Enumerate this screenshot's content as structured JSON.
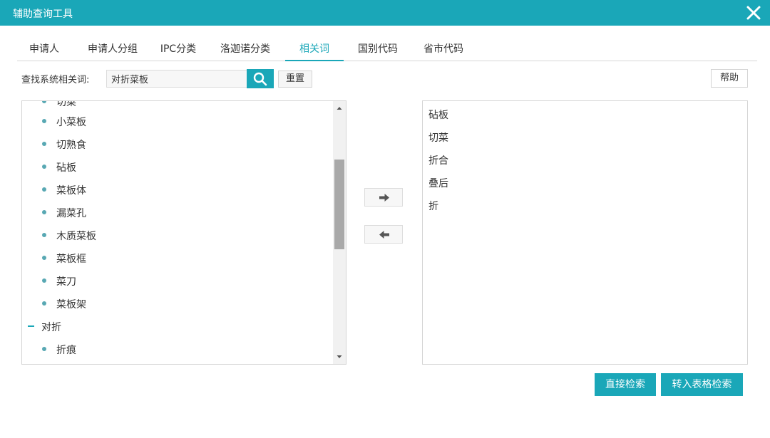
{
  "window": {
    "title": "辅助查询工具"
  },
  "tabs": [
    {
      "label": "申请人",
      "active": false
    },
    {
      "label": "申请人分组",
      "active": false
    },
    {
      "label": "IPC分类",
      "active": false
    },
    {
      "label": "洛迦诺分类",
      "active": false
    },
    {
      "label": "相关词",
      "active": true
    },
    {
      "label": "国别代码",
      "active": false
    },
    {
      "label": "省市代码",
      "active": false
    }
  ],
  "search": {
    "label": "查找系统相关词:",
    "value": "对折菜板",
    "reset_label": "重置",
    "help_label": "帮助"
  },
  "tree": {
    "items": [
      {
        "label": "切菜",
        "type": "leaf"
      },
      {
        "label": "小菜板",
        "type": "leaf"
      },
      {
        "label": "切熟食",
        "type": "leaf"
      },
      {
        "label": "砧板",
        "type": "leaf"
      },
      {
        "label": "菜板体",
        "type": "leaf"
      },
      {
        "label": "漏菜孔",
        "type": "leaf"
      },
      {
        "label": "木质菜板",
        "type": "leaf"
      },
      {
        "label": "菜板框",
        "type": "leaf"
      },
      {
        "label": "菜刀",
        "type": "leaf"
      },
      {
        "label": "菜板架",
        "type": "leaf"
      },
      {
        "label": "对折",
        "type": "group"
      },
      {
        "label": "折痕",
        "type": "leaf"
      }
    ]
  },
  "results": {
    "items": [
      "砧板",
      "切菜",
      "折合",
      "叠后",
      "折"
    ]
  },
  "actions": {
    "direct_search": "直接检索",
    "table_search": "转入表格检索"
  },
  "colors": {
    "accent": "#1aa7b8",
    "bullet": "#58a8b3"
  },
  "icons": {
    "close": "close-icon",
    "search": "search-icon",
    "move_right": "arrow-right-icon",
    "move_left": "arrow-left-icon"
  }
}
